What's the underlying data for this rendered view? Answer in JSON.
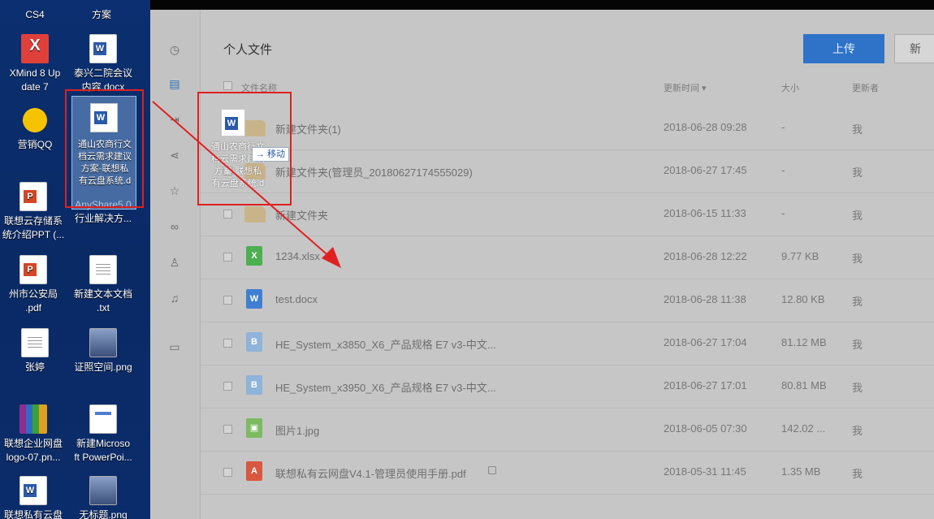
{
  "desktop": {
    "icons": [
      {
        "label": "CS4"
      },
      {
        "label": "方案"
      },
      {
        "label": "XMind 8 Up\ndate 7"
      },
      {
        "label": "泰兴二院会议\n内容.docx"
      },
      {
        "label": "营销QQ"
      },
      {
        "label": "联想云存储系\n统介绍PPT (..."
      },
      {
        "label": "AnyShare5.0\n行业解决方..."
      },
      {
        "label": "州市公安局\n.pdf"
      },
      {
        "label": "新建文本文档\n.txt"
      },
      {
        "label": "张婷"
      },
      {
        "label": "证照空间.png"
      },
      {
        "label": "联想企业网盘\nlogo-07.pn..."
      },
      {
        "label": "新建Microso\nft PowerPoi..."
      },
      {
        "label": "联想私有云盘"
      },
      {
        "label": "无标题.png"
      }
    ],
    "selected_file_label": "通山农商行文\n档云需求建议\n方案-联想私\n有云盘系统.d"
  },
  "sidebar": {
    "icons": [
      "clock-icon",
      "document-icon",
      "export-icon",
      "share-icon",
      "star-icon",
      "link-icon",
      "user-icon",
      "bell-icon",
      "monitor-icon"
    ]
  },
  "main": {
    "title": "个人文件",
    "upload_label": "上传",
    "new_label": "新",
    "headers": {
      "name": "文件名称",
      "time": "更新时间 ▾",
      "size": "大小",
      "owner": "更新者"
    },
    "rows": [
      {
        "name": "新建文件夹(1)",
        "time": "2018-06-28 09:28",
        "size": "-",
        "owner": "我",
        "type": "folder"
      },
      {
        "name": "新建文件夹(管理员_20180627174555029)",
        "time": "2018-06-27 17:45",
        "size": "-",
        "owner": "我",
        "type": "folder"
      },
      {
        "name": "新建文件夹",
        "time": "2018-06-15 11:33",
        "size": "-",
        "owner": "我",
        "type": "folder"
      },
      {
        "name": "1234.xlsx",
        "time": "2018-06-28 12:22",
        "size": "9.77 KB",
        "owner": "我",
        "type": "xlsx"
      },
      {
        "name": "test.docx",
        "time": "2018-06-28 11:38",
        "size": "12.80 KB",
        "owner": "我",
        "type": "docx"
      },
      {
        "name": "HE_System_x3850_X6_产品规格 E7 v3-中文...",
        "time": "2018-06-27 17:04",
        "size": "81.12 MB",
        "owner": "我",
        "type": "generic"
      },
      {
        "name": "HE_System_x3950_X6_产品规格 E7 v3-中文...",
        "time": "2018-06-27 17:01",
        "size": "80.81 MB",
        "owner": "我",
        "type": "generic"
      },
      {
        "name": "图片1.jpg",
        "time": "2018-06-05 07:30",
        "size": "142.02 ...",
        "owner": "我",
        "type": "jpg"
      },
      {
        "name": "联想私有云网盘V4.1-管理员使用手册.pdf",
        "time": "2018-05-31 11:45",
        "size": "1.35 MB",
        "owner": "我",
        "type": "pdf"
      }
    ]
  },
  "drag": {
    "ghost_label": "通山农商行文\n档云需求建议\n方案-联想私\n有云盘系统.d",
    "move_tip": "→ 移动"
  },
  "colors": {
    "desktop_bg": "#0b2f70",
    "accent": "#2e73c8",
    "highlight_box": "#e02020",
    "overlay_bg": "#bfbfbf"
  }
}
